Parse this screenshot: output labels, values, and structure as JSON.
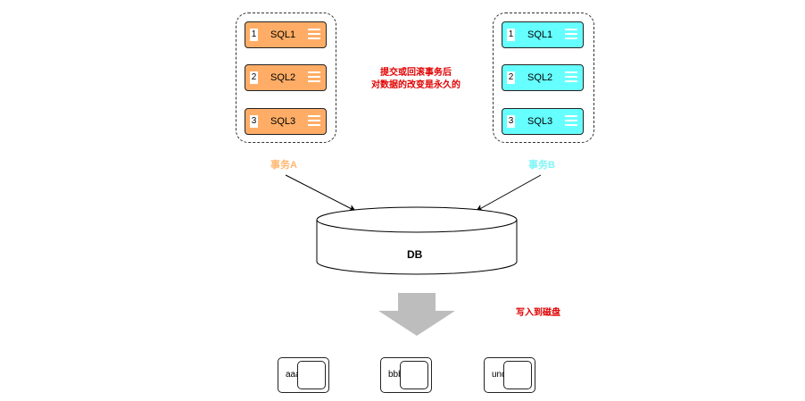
{
  "colors": {
    "transaction_a": "#ffad66",
    "transaction_b": "#66ffff",
    "transaction_a_label": "#ffb870",
    "transaction_b_label": "#7ff5f5",
    "note_red": "#e00000",
    "arrow_gray": "#bdbdbd"
  },
  "transaction_a": {
    "label": "事务A",
    "items": [
      {
        "num": "1",
        "sql": "SQL1"
      },
      {
        "num": "2",
        "sql": "SQL2"
      },
      {
        "num": "3",
        "sql": "SQL3"
      }
    ]
  },
  "transaction_b": {
    "label": "事务B",
    "items": [
      {
        "num": "1",
        "sql": "SQL1"
      },
      {
        "num": "2",
        "sql": "SQL2"
      },
      {
        "num": "3",
        "sql": "SQL3"
      }
    ]
  },
  "note": {
    "line1": "提交或回滚事务后",
    "line2": "对数据的改变是永久的"
  },
  "db": {
    "label": "DB"
  },
  "disk_note": "写入到磁盘",
  "files": [
    {
      "label": "aaa"
    },
    {
      "label": "bbb"
    },
    {
      "label": "undo"
    }
  ]
}
